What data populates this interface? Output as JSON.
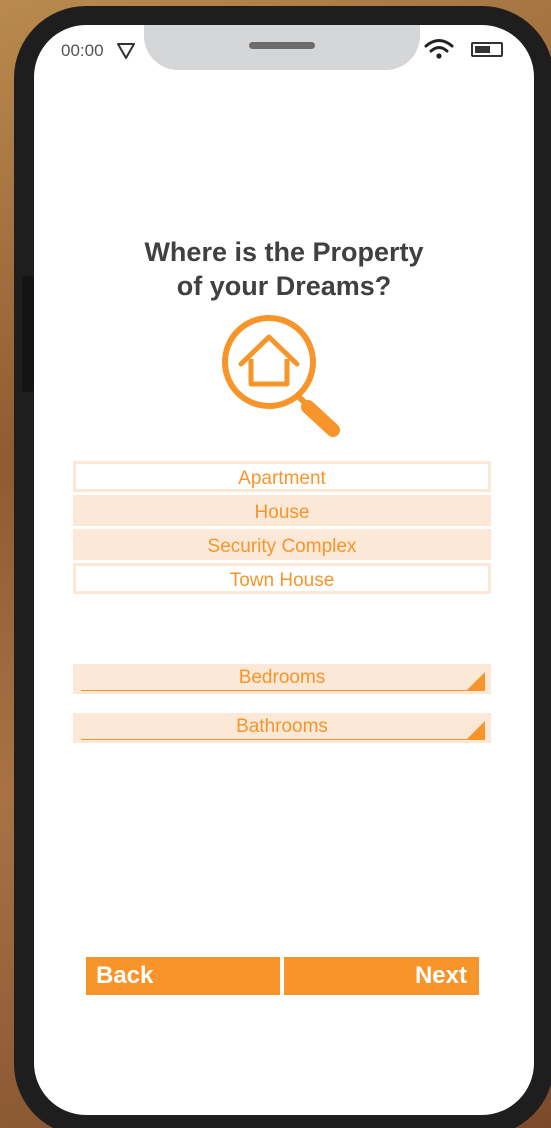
{
  "status_bar": {
    "time": "00:00"
  },
  "title": {
    "line1": "Where is the Property",
    "line2": "of your Dreams?"
  },
  "property_types": [
    {
      "label": "Apartment",
      "selected": false
    },
    {
      "label": "House",
      "selected": true
    },
    {
      "label": "Security Complex",
      "selected": true
    },
    {
      "label": "Town House",
      "selected": false
    }
  ],
  "dropdowns": {
    "bedrooms": "Bedrooms",
    "bathrooms": "Bathrooms"
  },
  "buttons": {
    "back": "Back",
    "next": "Next"
  },
  "colors": {
    "accent": "#f7952a",
    "accent_light": "#fbe8d6",
    "title": "#404041"
  }
}
